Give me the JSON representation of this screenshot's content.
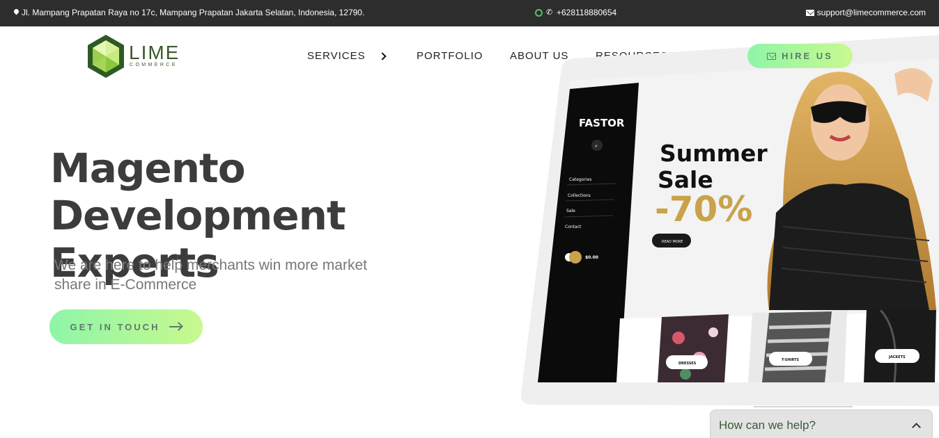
{
  "topbar": {
    "address": "Jl. Mampang Prapatan Raya no 17c, Mampang Prapatan Jakarta Selatan, Indonesia, 12790.",
    "phone": "+628118880654",
    "email": "support@limecommerce.com",
    "bg_color": "#2d2d2d"
  },
  "logo": {
    "word": "LIME",
    "sub": "COMMERCE"
  },
  "nav": {
    "items": [
      {
        "label": "SERVICES",
        "has_submenu": true
      },
      {
        "label": "PORTFOLIO",
        "has_submenu": false
      },
      {
        "label": "ABOUT US",
        "has_submenu": false
      },
      {
        "label": "RESOURCES",
        "has_submenu": true
      }
    ],
    "hire_label": "HIRE US"
  },
  "hero": {
    "title_line1": "Magento Development",
    "title_line2": "Experts",
    "subtitle_line1": "We are here to help merchants win more market",
    "subtitle_line2": "share in E-Commerce",
    "cta_label": "GET IN TOUCH"
  },
  "mockup": {
    "store_name": "FASTOR",
    "menu": [
      "Categories",
      "Collections",
      "Sale",
      "Contact"
    ],
    "cart_total": "$0.00",
    "promo_line1": "Summer",
    "promo_line2": "Sale",
    "promo_discount": "-70%",
    "read_more": "READ MORE",
    "tiles": [
      "DRESSES",
      "T-SHIRTS",
      "JACKETS"
    ]
  },
  "chat": {
    "label": "How can we help?"
  },
  "colors": {
    "accent_start": "#8ef5a8",
    "accent_end": "#c9f98f",
    "logo_green": "#3a5a2a",
    "gold": "#c9a24a"
  }
}
